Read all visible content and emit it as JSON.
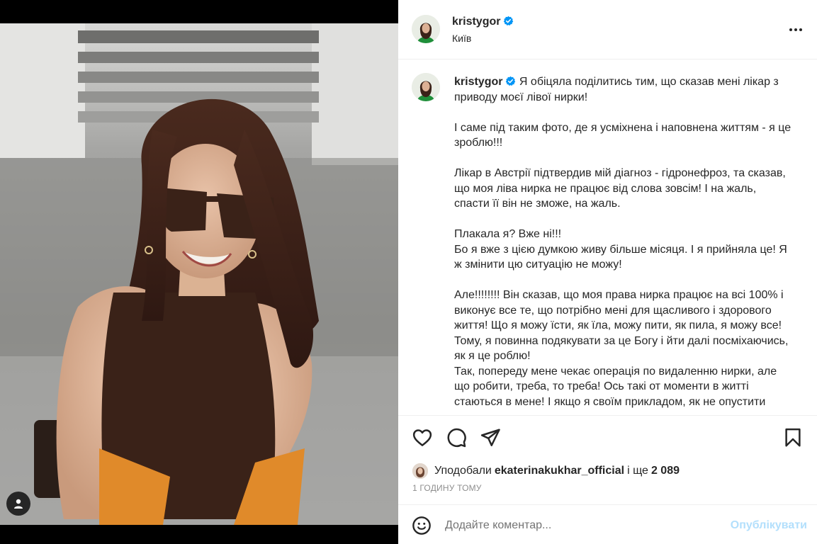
{
  "photo": {
    "alt_icon": "user-tag-icon"
  },
  "post": {
    "username": "kristygor",
    "location": "Київ",
    "verified": true
  },
  "caption": {
    "username": "kristygor",
    "p1": "Я обіцяла поділитись тим, що сказав мені лікар з приводу моєї лівої нирки!",
    "p2": "І саме під таким фото, де я усміхнена і наповнена життям - я це зроблю!!!",
    "p3": "Лікар в Австрії підтвердив мій діагноз - гідронефроз, та сказав, що моя ліва нирка не працює від слова зовсім! І на жаль, спасти її він не зможе, на жаль.",
    "p4a": "Плакала я? Вже ні!!!",
    "p4b": "Бо я вже з цією думкою живу більше місяця. І я прийняла це! Я ж змінити цю ситуацію не можу!",
    "p5a": "Але!!!!!!!! Він сказав, що моя права нирка працює на всі 100% і виконує все те, що потрібно мені для щасливого і здорового життя! Що я можу їсти, як їла, можу пити, як пила, я можу все!",
    "p5b": "Тому, я повинна подякувати за це Богу і йти далі посміхаючись, як я це роблю!",
    "p5c": "Так, попереду мене чекає операція по видаленню нирки, але що робити, треба, то треба! Ось такі от моменти в житті стаються в мене! І якщо я своїм прикладом, як не опустити"
  },
  "likes": {
    "prefix": "Уподобали",
    "liker": "ekaterinakukhar_official",
    "middle": "і ще",
    "count": "2 089"
  },
  "timestamp": "1 ГОДИНУ ТОМУ",
  "comment": {
    "placeholder": "Додайте коментар...",
    "publish_label": "Опублікувати"
  },
  "icons": {
    "like": "heart-icon",
    "comment": "comment-icon",
    "share": "paper-plane-icon",
    "save": "bookmark-icon",
    "more": "more-dots-icon",
    "emoji": "emoji-icon",
    "verified": "verified-badge-icon"
  },
  "colors": {
    "verified": "#0095f6",
    "publish_disabled": "#b2dffc",
    "text": "#262626",
    "muted": "#8e8e8e"
  }
}
